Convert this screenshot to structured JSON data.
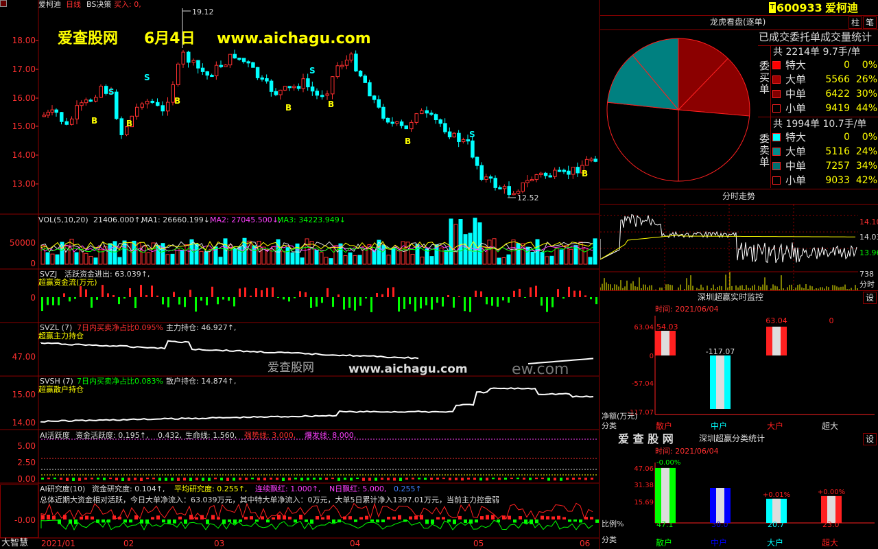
{
  "stock": {
    "name": "爱柯迪",
    "code": "600933",
    "chart_type": "日线",
    "bs_label": "BS决策",
    "buy_label": "买入: 0,"
  },
  "watermark": {
    "site": "爱查股网",
    "date": "6月4日",
    "url": "www.aichagu.com",
    "url2": "www.aichagu.com",
    "site2": "爱查股网",
    "tail": "ew.com"
  },
  "price_axis": [
    "18.00",
    "17.00",
    "16.00",
    "15.00",
    "14.00",
    "13.00"
  ],
  "price_marks": {
    "high": "19.12",
    "low": "12.52"
  },
  "vol": {
    "label": "VOL(5,10,20)",
    "val": "21406.000↑,",
    "ma1": "MA1: 26660.199↓,",
    "ma2": "MA2: 27045.500↓,",
    "ma3": "MA3: 34223.949↓",
    "axis": [
      "50000",
      "0"
    ]
  },
  "svzj": {
    "label": "SVZJ",
    "t1": "活跃资金进出: 63.039↑,",
    "t2": "超赢资金流(万元)",
    "axis": "0"
  },
  "svzl": {
    "label": "SVZL (7)",
    "t1": "7日内买卖净占比0.095%",
    "t2": "主力持仓: 46.927↑,",
    "t3": "超赢主力持仓",
    "axis": "47.00"
  },
  "svsh": {
    "label": "SVSH (7)",
    "t1": "7日内买卖净占比0.083%",
    "t2": "散户持仓: 14.874↑,",
    "t3": "超赢散户持仓",
    "axis": [
      "15.00",
      "14.00"
    ]
  },
  "ai1": {
    "t1": "AI活跃度",
    "t2": "资金活跃度: 0.195↑,",
    "t3": "0.432,",
    "t4": "生命线: 1.560,",
    "t5": "强势线: 3.000,",
    "t6": "爆发线: 8.000,",
    "axis": [
      "5.00",
      "2.50",
      "0.00"
    ]
  },
  "ai2": {
    "t1": "AI研究度(10)",
    "t2": "资金研究度: 0.104↑,",
    "t3": "平均研究度: 0.255↑,",
    "t4": "连续飘红: 1.000↑,",
    "t5": "N日飘红: 5.000,",
    "t6": "0.255↑",
    "line2": "总体近期大资金相对活跃，今日大单净流入：63.039万元，其中特大单净流入：0万元，大单5日累计净入1397.01万元，当前主力控盘弱",
    "axis": "-0.00"
  },
  "bottom": {
    "brand": "大智慧",
    "dates": [
      "2021/01",
      "02",
      "03",
      "04",
      "05",
      "06"
    ]
  },
  "right": {
    "title_code": "600933",
    "title_name": "爱柯迪",
    "btn1": "柱",
    "btn2": "笔",
    "lh_title": "龙虎看盘(逐单)",
    "stat_title": "已成交委托单成交量统计",
    "buy_label": "委买单",
    "buy_total": "共 2214单 9.7手/单",
    "buy_rows": [
      {
        "name": "特大",
        "n": "0",
        "p": "0%",
        "color": "#ff0000"
      },
      {
        "name": "大单",
        "n": "5566",
        "p": "26%",
        "color": "#a00000"
      },
      {
        "name": "中单",
        "n": "6422",
        "p": "30%",
        "color": "#800000"
      },
      {
        "name": "小单",
        "n": "9419",
        "p": "44%",
        "color": "#000"
      }
    ],
    "sell_label": "委卖单",
    "sell_total": "共 1994单 10.7手/单",
    "sell_rows": [
      {
        "name": "特大",
        "n": "0",
        "p": "0%",
        "color": "#00ffff"
      },
      {
        "name": "大单",
        "n": "5116",
        "p": "24%",
        "color": "#008b8b"
      },
      {
        "name": "中单",
        "n": "7257",
        "p": "34%",
        "color": "#007070"
      },
      {
        "name": "小单",
        "n": "9033",
        "p": "42%",
        "color": "#000"
      }
    ],
    "fs_title": "分时走势",
    "fs_axis": [
      "14.10",
      "14.03",
      "13.96"
    ],
    "fs_vol": "738",
    "fs_vol2": "分时",
    "m1_title": "深圳超赢实时监控",
    "m1_btn": "设",
    "m1_time": "时间: 2021/06/04",
    "m1_axis": [
      "63.04",
      "0",
      "-57.04",
      "-117.07"
    ],
    "m1_ylabel": "净额(万元)",
    "m1_xlabel": "分类",
    "m1_vals": [
      "54.03",
      "-117.07",
      "63.04",
      "0"
    ],
    "m1_cats": [
      "散户",
      "中户",
      "大户",
      "超大"
    ],
    "m2_brand": "爱 查 股 网",
    "m2_title": "深圳超赢分类统计",
    "m2_btn": "设",
    "m2_time": "时间: 2021/06/04",
    "m2_axis": [
      "47.06",
      "31.38",
      "15.69"
    ],
    "m2_ylabel": "比例%",
    "m2_xlabel": "分类",
    "m2_top": [
      "-0.00%",
      "",
      "+0.01%",
      "+0.00%"
    ],
    "m2_vals": [
      "47.1",
      "30.0",
      "20.7",
      "23.0"
    ],
    "m2_cats": [
      "散户",
      "中户",
      "大户",
      "超大"
    ]
  }
}
